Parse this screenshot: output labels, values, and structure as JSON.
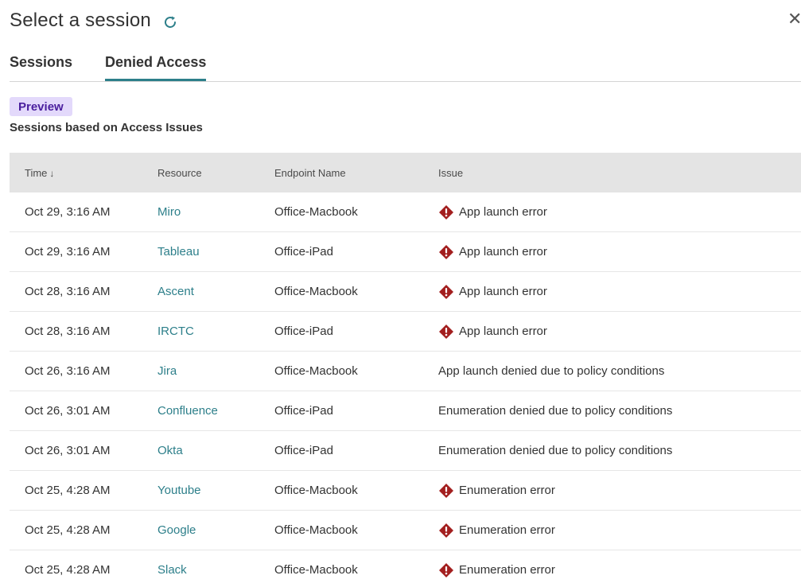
{
  "header": {
    "title": "Select a session",
    "close_glyph": "✕"
  },
  "tabs": [
    {
      "label": "Sessions",
      "active": false
    },
    {
      "label": "Denied Access",
      "active": true
    }
  ],
  "badge": "Preview",
  "subtitle": "Sessions based on Access Issues",
  "colors": {
    "accent": "#2d7f8a",
    "error": "#a31f1f",
    "badge_bg": "#e3d9fb",
    "badge_text": "#4a1e9e",
    "header_bg": "#e4e4e4"
  },
  "table": {
    "columns": {
      "time": "Time",
      "sort_indicator": "↓",
      "resource": "Resource",
      "endpoint": "Endpoint Name",
      "issue": "Issue"
    },
    "rows": [
      {
        "time": "Oct 29, 3:16 AM",
        "resource": "Miro",
        "endpoint": "Office-Macbook",
        "issue": "App launch error",
        "error_icon": true
      },
      {
        "time": "Oct 29, 3:16 AM",
        "resource": "Tableau",
        "endpoint": "Office-iPad",
        "issue": "App launch error",
        "error_icon": true
      },
      {
        "time": "Oct 28, 3:16 AM",
        "resource": "Ascent",
        "endpoint": "Office-Macbook",
        "issue": "App launch error",
        "error_icon": true
      },
      {
        "time": "Oct 28, 3:16 AM",
        "resource": "IRCTC",
        "endpoint": "Office-iPad",
        "issue": "App launch error",
        "error_icon": true
      },
      {
        "time": "Oct 26, 3:16 AM",
        "resource": "Jira",
        "endpoint": "Office-Macbook",
        "issue": "App launch denied due to policy conditions",
        "error_icon": false
      },
      {
        "time": "Oct 26, 3:01 AM",
        "resource": "Confluence",
        "endpoint": "Office-iPad",
        "issue": "Enumeration denied due to policy conditions",
        "error_icon": false
      },
      {
        "time": "Oct 26, 3:01 AM",
        "resource": "Okta",
        "endpoint": "Office-iPad",
        "issue": "Enumeration denied due to policy conditions",
        "error_icon": false
      },
      {
        "time": "Oct 25, 4:28 AM",
        "resource": "Youtube",
        "endpoint": "Office-Macbook",
        "issue": "Enumeration error",
        "error_icon": true
      },
      {
        "time": "Oct 25, 4:28 AM",
        "resource": "Google",
        "endpoint": "Office-Macbook",
        "issue": "Enumeration error",
        "error_icon": true
      },
      {
        "time": "Oct 25, 4:28 AM",
        "resource": "Slack",
        "endpoint": "Office-Macbook",
        "issue": "Enumeration error",
        "error_icon": true
      }
    ]
  }
}
